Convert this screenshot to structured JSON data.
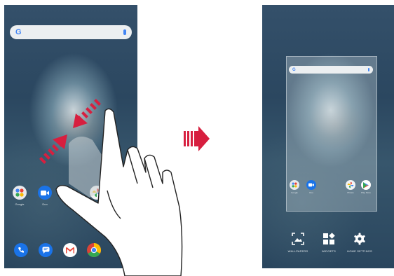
{
  "left_screen": {
    "search": {
      "logo": "G"
    },
    "apps": [
      {
        "label": "Google"
      },
      {
        "label": "Duo"
      }
    ],
    "dock_icons": [
      "phone-icon",
      "messages-icon",
      "gmail-icon",
      "chrome-icon"
    ]
  },
  "right_screen": {
    "search": {
      "logo": "G"
    },
    "apps": [
      {
        "label": "Google"
      },
      {
        "label": "Duo"
      },
      {
        "label": "Photos"
      },
      {
        "label": "Play Store"
      }
    ],
    "menu": [
      {
        "label": "WALLPAPERS",
        "icon": "wallpaper-icon"
      },
      {
        "label": "WIDGETS",
        "icon": "widgets-icon"
      },
      {
        "label": "HOME SETTINGS",
        "icon": "gear-icon"
      }
    ]
  },
  "colors": {
    "arrow": "#d71f3f",
    "google_blue": "#4285f4",
    "wallpaper": "#2b4760"
  }
}
